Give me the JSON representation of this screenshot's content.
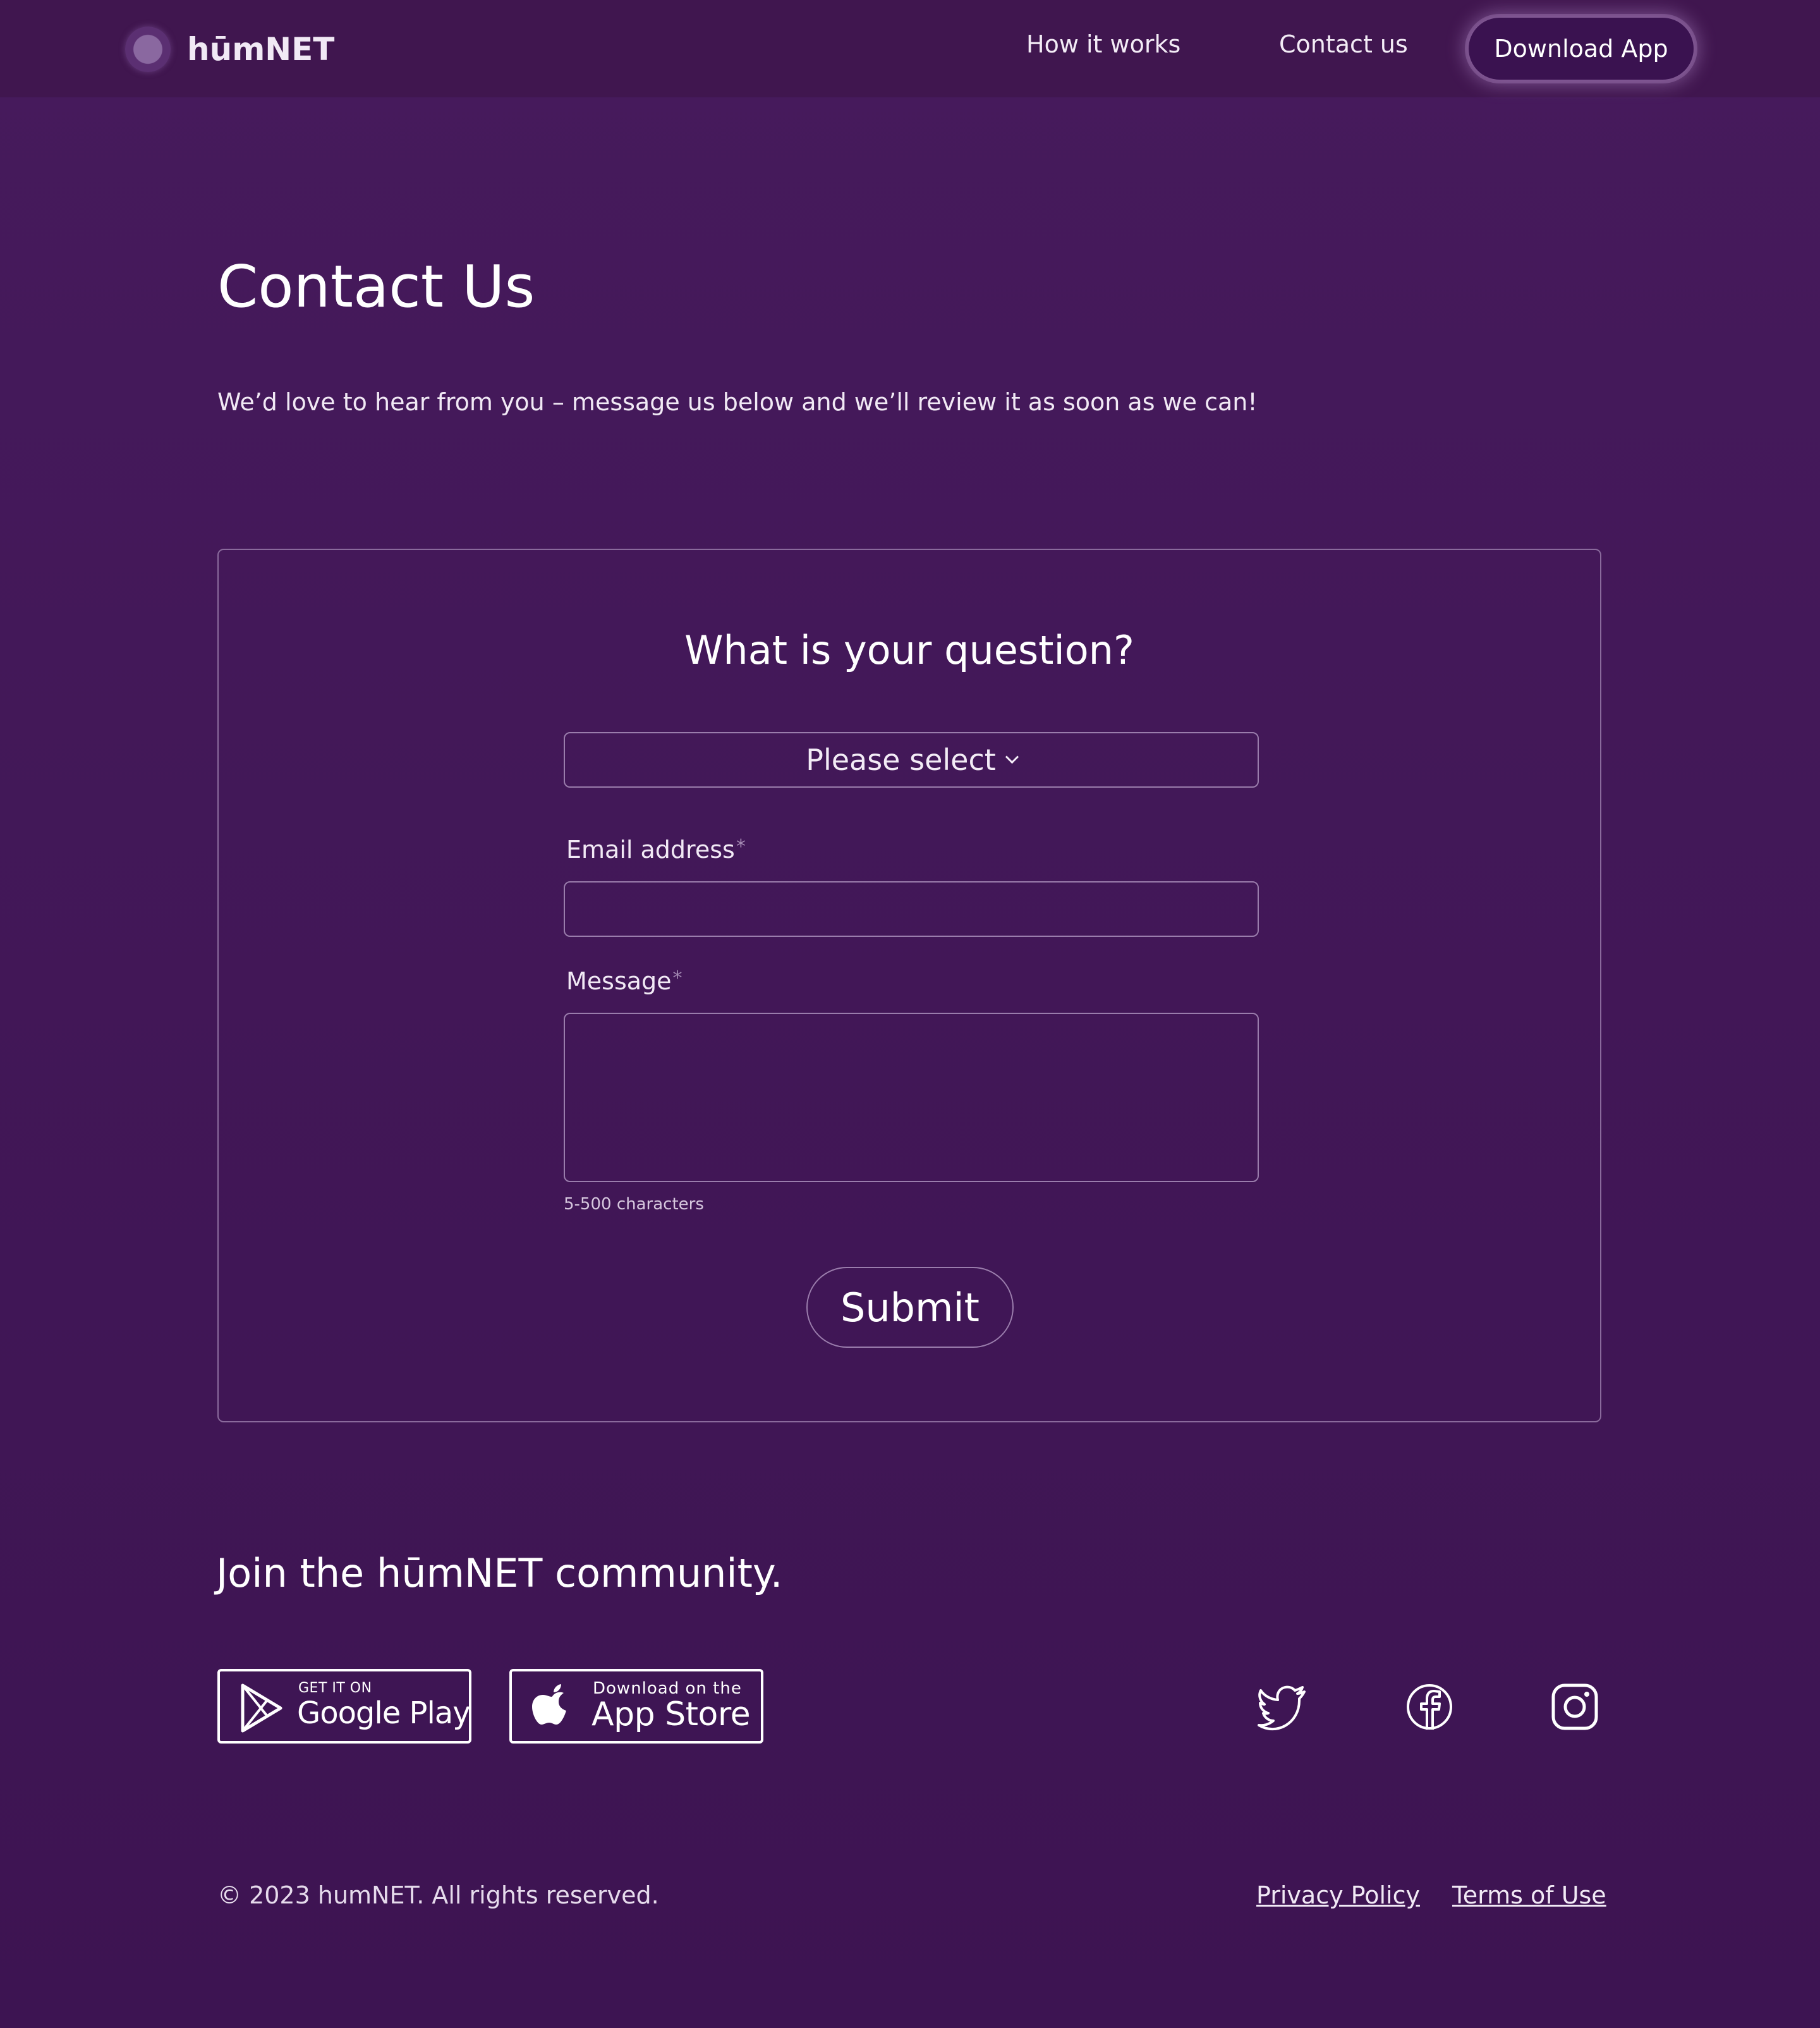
{
  "brand": {
    "name": "hūmNET"
  },
  "nav": {
    "how_it_works": "How it works",
    "contact_us": "Contact us",
    "download_app": "Download App"
  },
  "main": {
    "title": "Contact Us",
    "intro": "We’d love to hear from you – message us below and we’ll review it as soon as we can!"
  },
  "form": {
    "heading": "What is your question?",
    "select_value": "Please select",
    "email_label": "Email address",
    "email_value": "",
    "message_label": "Message",
    "message_value": "",
    "required_marker": "*",
    "char_hint": "5-500 characters",
    "submit_label": "Submit"
  },
  "community": {
    "heading": "Join the hūmNET community.",
    "google_play": {
      "small": "GET IT ON",
      "big": "Google Play"
    },
    "app_store": {
      "small": "Download on the",
      "big": "App Store"
    },
    "social_icons": [
      "twitter-icon",
      "facebook-icon",
      "instagram-icon"
    ]
  },
  "footer": {
    "copyright": "© 2023 humNET. All rights reserved.",
    "privacy": "Privacy Policy",
    "terms": "Terms of Use"
  },
  "colors": {
    "background": "#44185a",
    "header": "#40164f",
    "border": "#9a7dac",
    "text": "#ffffff"
  }
}
